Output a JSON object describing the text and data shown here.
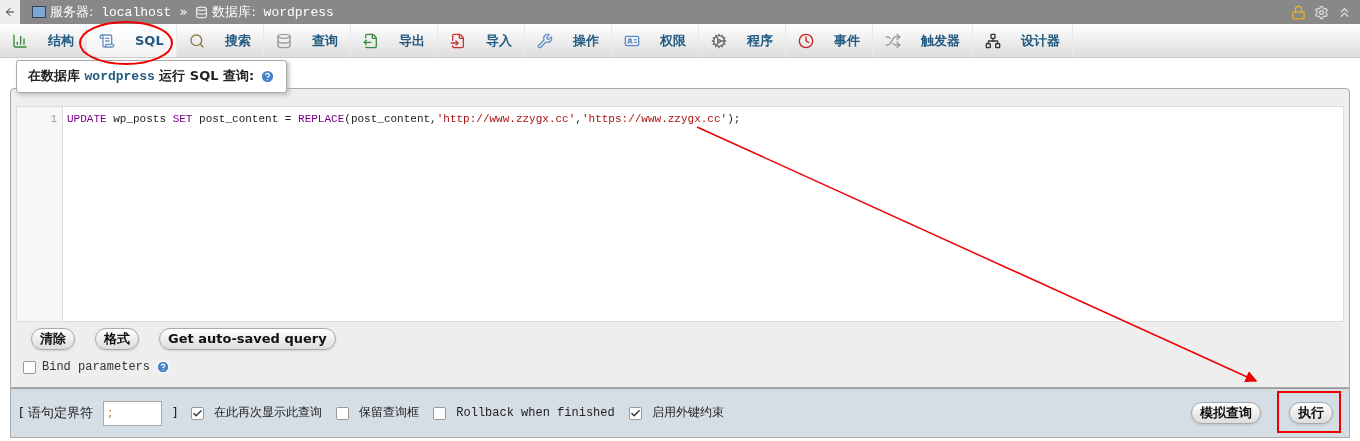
{
  "breadcrumb": [
    {
      "label": "服务器:",
      "value": "localhost"
    },
    {
      "label": "数据库:",
      "value": "wordpress"
    }
  ],
  "breadcrumb_separator": "»",
  "tabs": [
    {
      "label": "结构",
      "selected": false
    },
    {
      "label": "SQL",
      "selected": true
    },
    {
      "label": "搜索",
      "selected": false
    },
    {
      "label": "查询",
      "selected": false
    },
    {
      "label": "导出",
      "selected": false
    },
    {
      "label": "导入",
      "selected": false
    },
    {
      "label": "操作",
      "selected": false
    },
    {
      "label": "权限",
      "selected": false
    },
    {
      "label": "程序",
      "selected": false
    },
    {
      "label": "事件",
      "selected": false
    },
    {
      "label": "触发器",
      "selected": false
    },
    {
      "label": "设计器",
      "selected": false
    }
  ],
  "legend": {
    "prefix": "在数据库",
    "database": "wordpress",
    "suffix": "运行 SQL 查询:"
  },
  "editor": {
    "line_numbers": [
      "1"
    ],
    "tokens": [
      {
        "text": "UPDATE",
        "kind": "keyword"
      },
      {
        "text": " wp_posts ",
        "kind": "plain"
      },
      {
        "text": "SET",
        "kind": "keyword"
      },
      {
        "text": " post_content = ",
        "kind": "plain"
      },
      {
        "text": "REPLACE",
        "kind": "keyword"
      },
      {
        "text": "(post_content,",
        "kind": "plain"
      },
      {
        "text": "'http://www.zzygx.cc'",
        "kind": "string"
      },
      {
        "text": ",",
        "kind": "plain"
      },
      {
        "text": "'https://www.zzygx.cc'",
        "kind": "string"
      },
      {
        "text": ");",
        "kind": "plain"
      }
    ]
  },
  "editor_buttons": [
    "清除",
    "格式",
    "Get auto-saved query"
  ],
  "bind_parameters": {
    "label": "Bind parameters",
    "checked": false
  },
  "delimiter": {
    "label_open": "[ 语句定界符",
    "value": ";",
    "label_close": "]"
  },
  "options": [
    {
      "label": "在此再次显示此查询",
      "checked": true
    },
    {
      "label": "保留查询框",
      "checked": false
    },
    {
      "label": "Rollback when finished",
      "checked": false
    },
    {
      "label": "启用外键约束",
      "checked": true
    }
  ],
  "simulate_button": "模拟查询",
  "go_button": "执行"
}
